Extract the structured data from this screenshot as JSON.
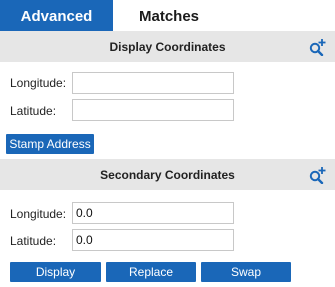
{
  "tabs": [
    {
      "label": "Advanced",
      "active": true
    },
    {
      "label": "Matches",
      "active": false
    }
  ],
  "display_coordinates": {
    "title": "Display Coordinates",
    "longitude_label": "Longitude:",
    "longitude_value": "",
    "latitude_label": "Latitude:",
    "latitude_value": "",
    "stamp_button_label": "Stamp Address",
    "icon": "zoom-in-icon"
  },
  "secondary_coordinates": {
    "title": "Secondary Coordinates",
    "longitude_label": "Longitude:",
    "longitude_value": "0.0",
    "latitude_label": "Latitude:",
    "latitude_value": "0.0",
    "icon": "zoom-in-icon"
  },
  "actions": {
    "display_label": "Display",
    "replace_label": "Replace",
    "swap_label": "Swap"
  },
  "colors": {
    "accent": "#1a67b8",
    "header_bg": "#e6e6e6"
  }
}
